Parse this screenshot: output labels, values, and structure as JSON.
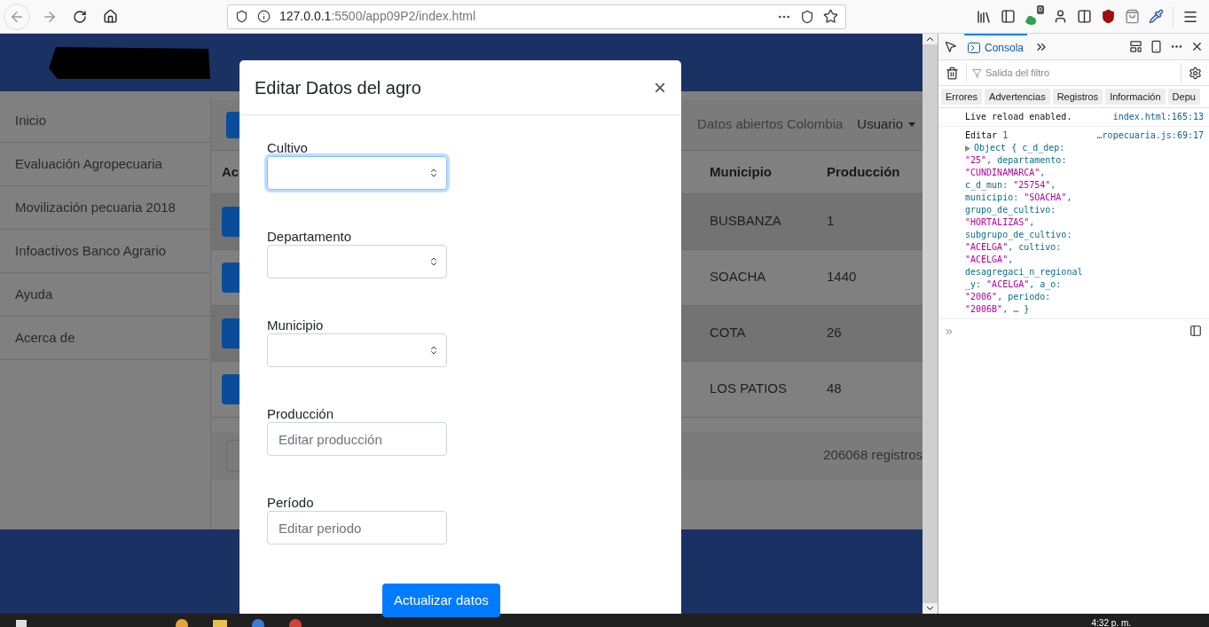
{
  "browser": {
    "url_host": "127.0.0.1",
    "url_rest": ":5500/app09P2/index.html",
    "extension_badge": "0"
  },
  "page": {
    "sidebar": {
      "items": [
        {
          "label": "Inicio"
        },
        {
          "label": "Evaluación Agropecuaria"
        },
        {
          "label": "Movilización pecuaria 2018"
        },
        {
          "label": "Infoactivos Banco Agrario"
        },
        {
          "label": "Ayuda"
        },
        {
          "label": "Acerca de"
        }
      ]
    },
    "topbar": {
      "site_link": "Datos abiertos Colombia",
      "user_menu": "Usuario"
    },
    "table": {
      "columns": [
        "Ac",
        "Municipio",
        "Producción"
      ],
      "rows": [
        {
          "municipio": "BUSBANZA",
          "produccion": "1"
        },
        {
          "municipio": "SOACHA",
          "produccion": "1440"
        },
        {
          "municipio": "COTA",
          "produccion": "26"
        },
        {
          "municipio": "LOS PATIOS",
          "produccion": "48"
        }
      ],
      "record_count": "206068 registros"
    }
  },
  "modal": {
    "title": "Editar Datos del agro",
    "close": "×",
    "fields": [
      {
        "kind": "select",
        "label": "Cultivo",
        "focused": true
      },
      {
        "kind": "select",
        "label": "Departamento",
        "focused": false
      },
      {
        "kind": "select",
        "label": "Municipio",
        "focused": false
      },
      {
        "kind": "input",
        "label": "Producción",
        "placeholder": "Editar producción",
        "focused": false
      },
      {
        "kind": "input",
        "label": "Período",
        "placeholder": "Editar periodo",
        "focused": false
      }
    ],
    "submit": "Actualizar datos"
  },
  "devtools": {
    "tabs": [
      {
        "label": "Consola",
        "selected": true
      }
    ],
    "filter_placeholder": "Salida del filtro",
    "filters": [
      "Errores",
      "Advertencias",
      "Registros",
      "Información",
      "Depu"
    ],
    "logs": [
      {
        "message": "Live reload enabled.",
        "source": "index.html:165:13"
      },
      {
        "message": "Editar",
        "count": "1",
        "source": "…ropecuaria.js:69:17",
        "object_lines": [
          [
            {
              "kind": "plain",
              "text": "Object { c_d_dep:"
            }
          ],
          [
            {
              "kind": "string",
              "text": "\"25\""
            },
            {
              "kind": "plain",
              "text": ", departamento:"
            }
          ],
          [
            {
              "kind": "string",
              "text": "\"CUNDINAMARCA\""
            },
            {
              "kind": "plain",
              "text": ","
            }
          ],
          [
            {
              "kind": "plain",
              "text": "c_d_mun: "
            },
            {
              "kind": "string",
              "text": "\"25754\""
            },
            {
              "kind": "plain",
              "text": ","
            }
          ],
          [
            {
              "kind": "plain",
              "text": "municipio: "
            },
            {
              "kind": "string",
              "text": "\"SOACHA\""
            },
            {
              "kind": "plain",
              "text": ","
            }
          ],
          [
            {
              "kind": "plain",
              "text": "grupo_de_cultivo:"
            }
          ],
          [
            {
              "kind": "string",
              "text": "\"HORTALIZAS\""
            },
            {
              "kind": "plain",
              "text": ","
            }
          ],
          [
            {
              "kind": "plain",
              "text": "subgrupo_de_cultivo:"
            }
          ],
          [
            {
              "kind": "string",
              "text": "\"ACELGA\""
            },
            {
              "kind": "plain",
              "text": ", cultivo:"
            }
          ],
          [
            {
              "kind": "string",
              "text": "\"ACELGA\""
            },
            {
              "kind": "plain",
              "text": ","
            }
          ],
          [
            {
              "kind": "plain",
              "text": "desagregaci_n_regional"
            }
          ],
          [
            {
              "kind": "plain",
              "text": "_y: "
            },
            {
              "kind": "string",
              "text": "\"ACELGA\""
            },
            {
              "kind": "plain",
              "text": ", a_o:"
            }
          ],
          [
            {
              "kind": "string",
              "text": "\"2006\""
            },
            {
              "kind": "plain",
              "text": ", periodo:"
            }
          ],
          [
            {
              "kind": "string",
              "text": "\"2006B\""
            },
            {
              "kind": "plain",
              "text": ", … }"
            }
          ]
        ]
      }
    ],
    "prompt": "»"
  },
  "taskbar": {
    "clock": "4:32 p. m."
  }
}
